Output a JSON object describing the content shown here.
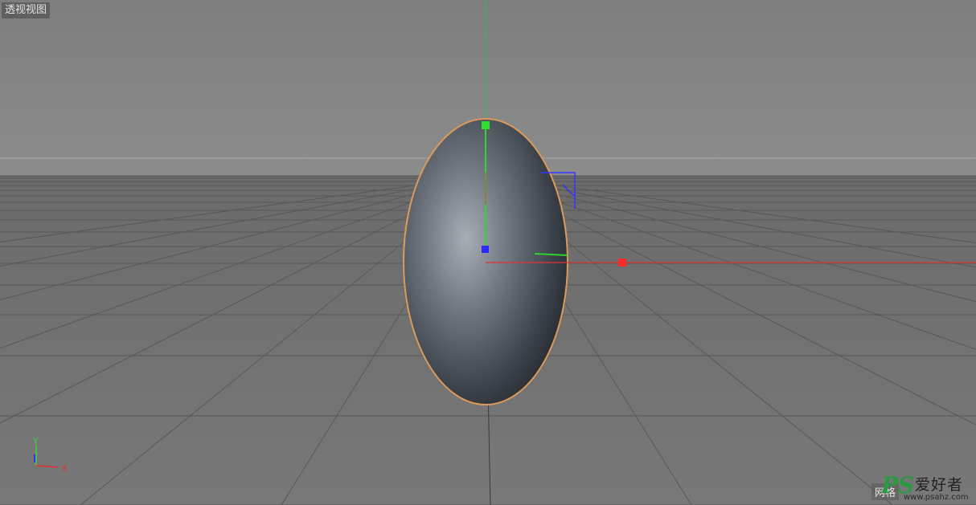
{
  "viewport": {
    "view_name": "透视视图",
    "overlay_text": "网格",
    "axis_gizmo": {
      "x_label": "X",
      "y_label": "Y"
    }
  },
  "watermark": {
    "logo_text": "PS",
    "chinese_text": "爱好者",
    "url": "www.psahz.com"
  },
  "colors": {
    "sky": "#858585",
    "floor": "#707070",
    "grid_line": "#5a5a5a",
    "object_outline": "#d99a5b",
    "x_axis": "#e03030",
    "y_axis": "#30c030",
    "z_axis": "#3030e0"
  }
}
